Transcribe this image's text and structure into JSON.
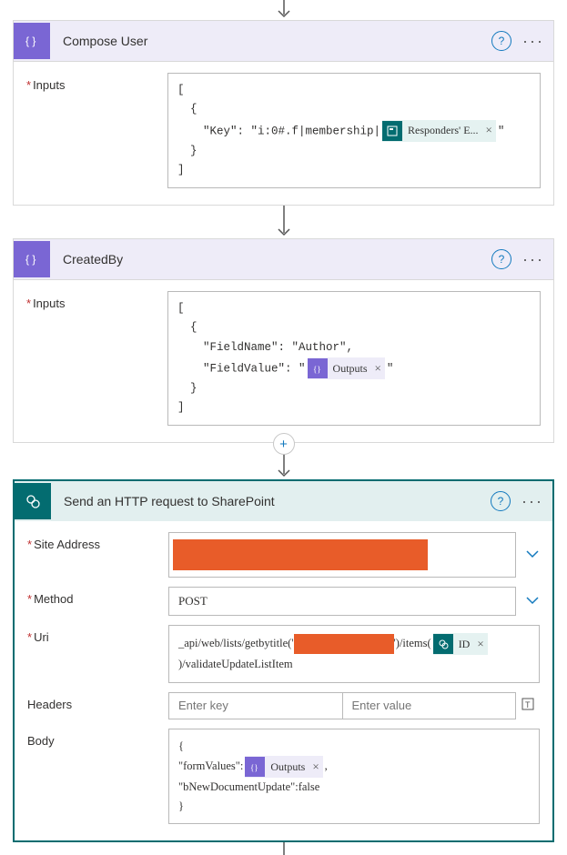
{
  "arrow_glyph": "↓",
  "actions": [
    {
      "id": "compose_user",
      "title": "Compose User",
      "style": "purple",
      "inputs_label": "Inputs",
      "code": {
        "l1": "[",
        "l2": "{",
        "l3_pre": "\"Key\": \"i:0#.f|membership|",
        "token_label": "Responders' E...",
        "l3_post": "\"",
        "l4": "}",
        "l5": "]"
      }
    },
    {
      "id": "created_by",
      "title": "CreatedBy",
      "style": "purple",
      "inputs_label": "Inputs",
      "code": {
        "l1": "[",
        "l2": "{",
        "l3": "\"FieldName\": \"Author\",",
        "l4_pre": "\"FieldValue\": \"",
        "token_label": "Outputs",
        "l4_post": "\"",
        "l5": "}",
        "l6": "]"
      }
    },
    {
      "id": "http_sp",
      "title": "Send an HTTP request to SharePoint",
      "style": "teal",
      "fields": {
        "site_label": "Site Address",
        "method_label": "Method",
        "method_value": "POST",
        "uri_label": "Uri",
        "uri_pre": "_api/web/lists/getbytitle('",
        "uri_mid": "')/items(",
        "uri_token": "ID",
        "uri_post": ")/validateUpdateListItem",
        "headers_label": "Headers",
        "headers_key_ph": "Enter key",
        "headers_val_ph": "Enter value",
        "body_label": "Body",
        "body": {
          "l1": "{",
          "l2_pre": "\"formValues\":",
          "token_label": "Outputs",
          "l2_post": ",",
          "l3": "\"bNewDocumentUpdate\":false",
          "l4": "}"
        }
      }
    }
  ]
}
